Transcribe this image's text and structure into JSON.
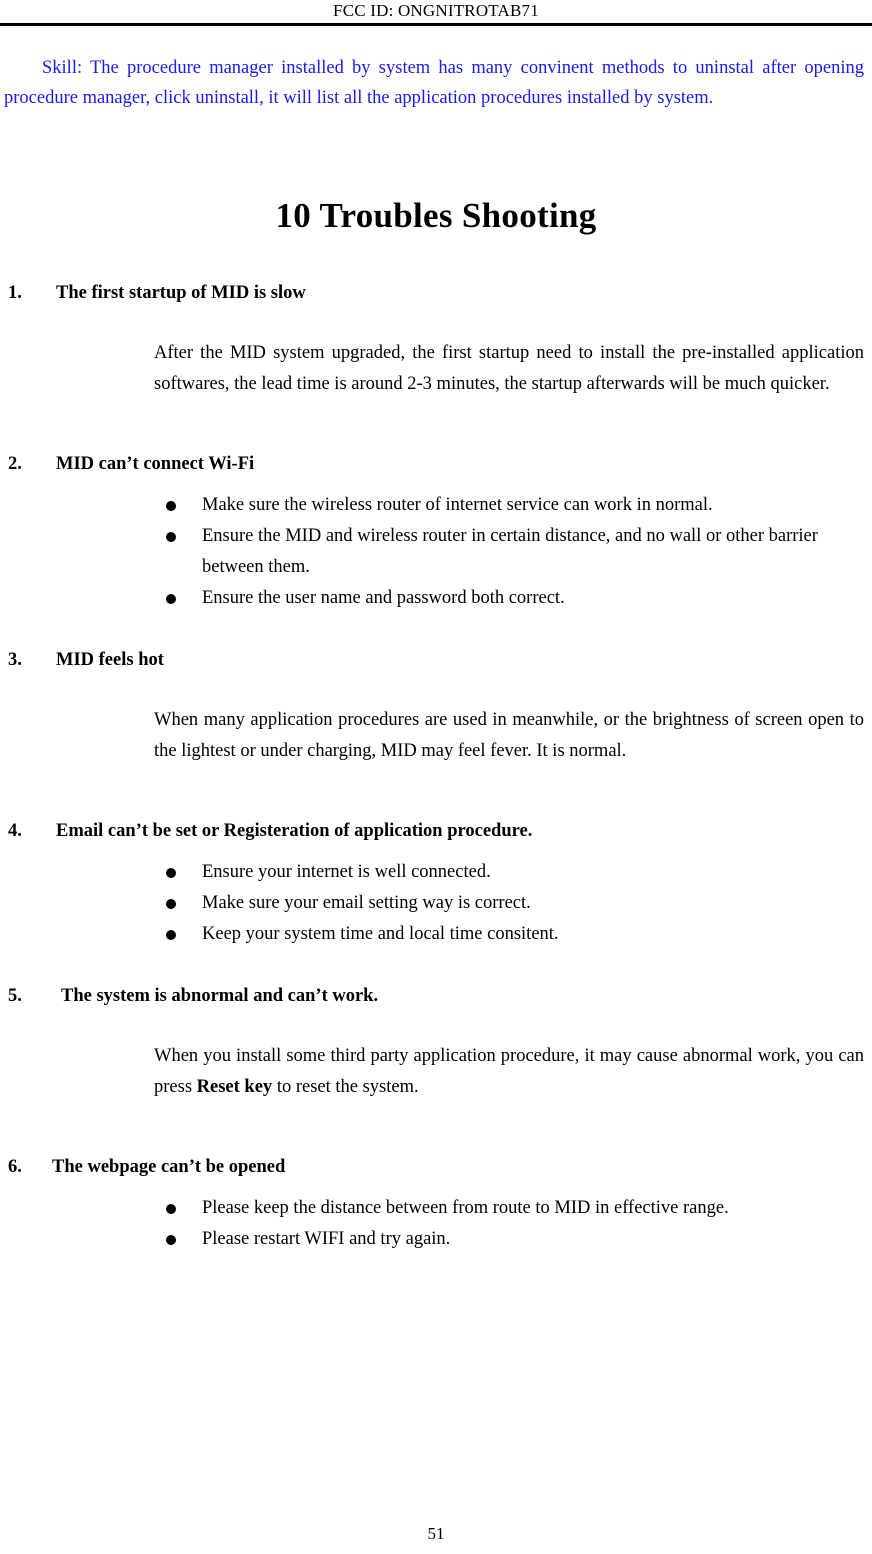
{
  "header": {
    "fcc_id": "FCC ID:  ONGNITROTAB71"
  },
  "skill_note": {
    "text": "Skill: The procedure manager installed by system has many convinent methods to uninstal after opening procedure manager, click uninstall, it will list all the application procedures installed by system.",
    "color": "#1a1aee"
  },
  "chapter": {
    "title": "10 Troubles Shooting"
  },
  "items": [
    {
      "number": "1.",
      "heading": "The first startup of MID is slow",
      "paragraph": "After the MID system upgraded, the first startup need to install the pre-installed application softwares, the lead time is around 2-3 minutes, the startup afterwards will be much quicker.",
      "bullets": []
    },
    {
      "number": "2.",
      "heading": "MID can’t connect Wi-Fi",
      "paragraph": "",
      "bullets": [
        "Make sure the wireless router of internet service can work in normal.",
        "Ensure the MID and wireless router in certain distance, and no wall or other barrier between them.",
        "Ensure the user name and password both correct."
      ]
    },
    {
      "number": "3.",
      "heading": "MID feels hot",
      "paragraph": "When many application procedures are used in meanwhile, or the brightness of screen open to the lightest or under charging, MID may feel fever. It is normal.",
      "bullets": []
    },
    {
      "number": "4.",
      "heading": "Email can’t be set or Registeration of application procedure.",
      "paragraph": "",
      "bullets": [
        "Ensure your internet is well connected.",
        "Make sure your email setting way is correct.",
        "Keep your system time and local time consitent."
      ]
    },
    {
      "number": "5.",
      "heading": "The system is abnormal and can’t work.",
      "paragraph_parts": {
        "before": "When you install some third party application procedure, it may cause abnormal work, you can press ",
        "bold": "Reset key",
        "after": " to reset the system."
      },
      "bullets": []
    },
    {
      "number": "6.",
      "heading": "The webpage can’t be opened",
      "paragraph": "",
      "bullets": [
        "Please keep the distance between from route to MID in effective range.",
        "Please restart WIFI and try again."
      ]
    }
  ],
  "footer": {
    "page_number": "51"
  }
}
